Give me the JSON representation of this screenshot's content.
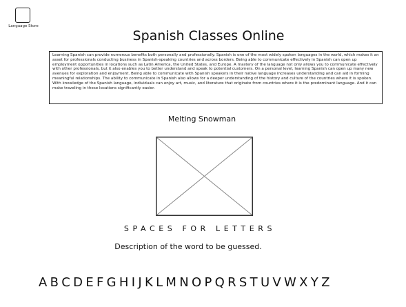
{
  "brand": {
    "caption": "Language Store"
  },
  "header": {
    "title": "Spanish Classes Online"
  },
  "intro": {
    "text": "Learning Spanish can provide numerous benefits both personally and professionally. Spanish is one of the most widely spoken languages in the world, which makes it an asset for professionals conducting business in Spanish-speaking countries and across borders. Being able to communicate effectively in Spanish can open up employment opportunities in locations such as Latin America, the United States, and Europe. A mastery of the language not only allows you to communicate effectively with other professionals, but it also enables you to better understand and speak to potential customers. On a personal level, learning Spanish can open up many new avenues for exploration and enjoyment. Being able to communicate with Spanish speakers in their native language increases understanding and can aid in forming meaningful relationships. The ability to communicate in Spanish also allows for a deeper understanding of the history and culture of the countries where it is spoken. With knowledge of the Spanish language, individuals can enjoy art, music, and literature that originate from countries where it is the predominant language. And it can make traveling in these locations significantly easier."
  },
  "game": {
    "image_caption": "Melting Snowman",
    "spaces_label": "SPACES FOR LETTERS",
    "description": "Description of the word to be guessed.",
    "letters": [
      "A",
      "B",
      "C",
      "D",
      "E",
      "F",
      "G",
      "H",
      "I",
      "J",
      "K",
      "L",
      "M",
      "N",
      "O",
      "P",
      "Q",
      "R",
      "S",
      "T",
      "U",
      "V",
      "W",
      "X",
      "Y",
      "Z"
    ]
  }
}
